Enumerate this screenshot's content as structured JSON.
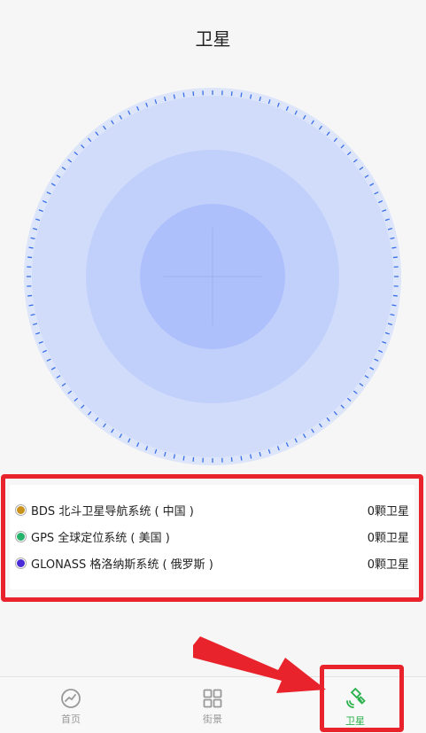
{
  "page": {
    "title": "卫星"
  },
  "systems": [
    {
      "name": "BDS 北斗卫星导航系统 ( 中国 )",
      "count": "0颗卫星",
      "color": "#c8921c"
    },
    {
      "name": "GPS 全球定位系统 ( 美国 )",
      "count": "0颗卫星",
      "color": "#26b36b"
    },
    {
      "name": "GLONASS 格洛纳斯系统 ( 俄罗斯 )",
      "count": "0颗卫星",
      "color": "#4a2bd6"
    }
  ],
  "tabs": [
    {
      "label": "首页",
      "icon": "speedometer-icon",
      "active": false
    },
    {
      "label": "街景",
      "icon": "grid-icon",
      "active": false
    },
    {
      "label": "卫星",
      "icon": "satellite-icon",
      "active": true
    }
  ],
  "colors": {
    "highlight": "#e8232c",
    "active_tab": "#2bb24c",
    "radar_tick": "#3a6fe8"
  }
}
